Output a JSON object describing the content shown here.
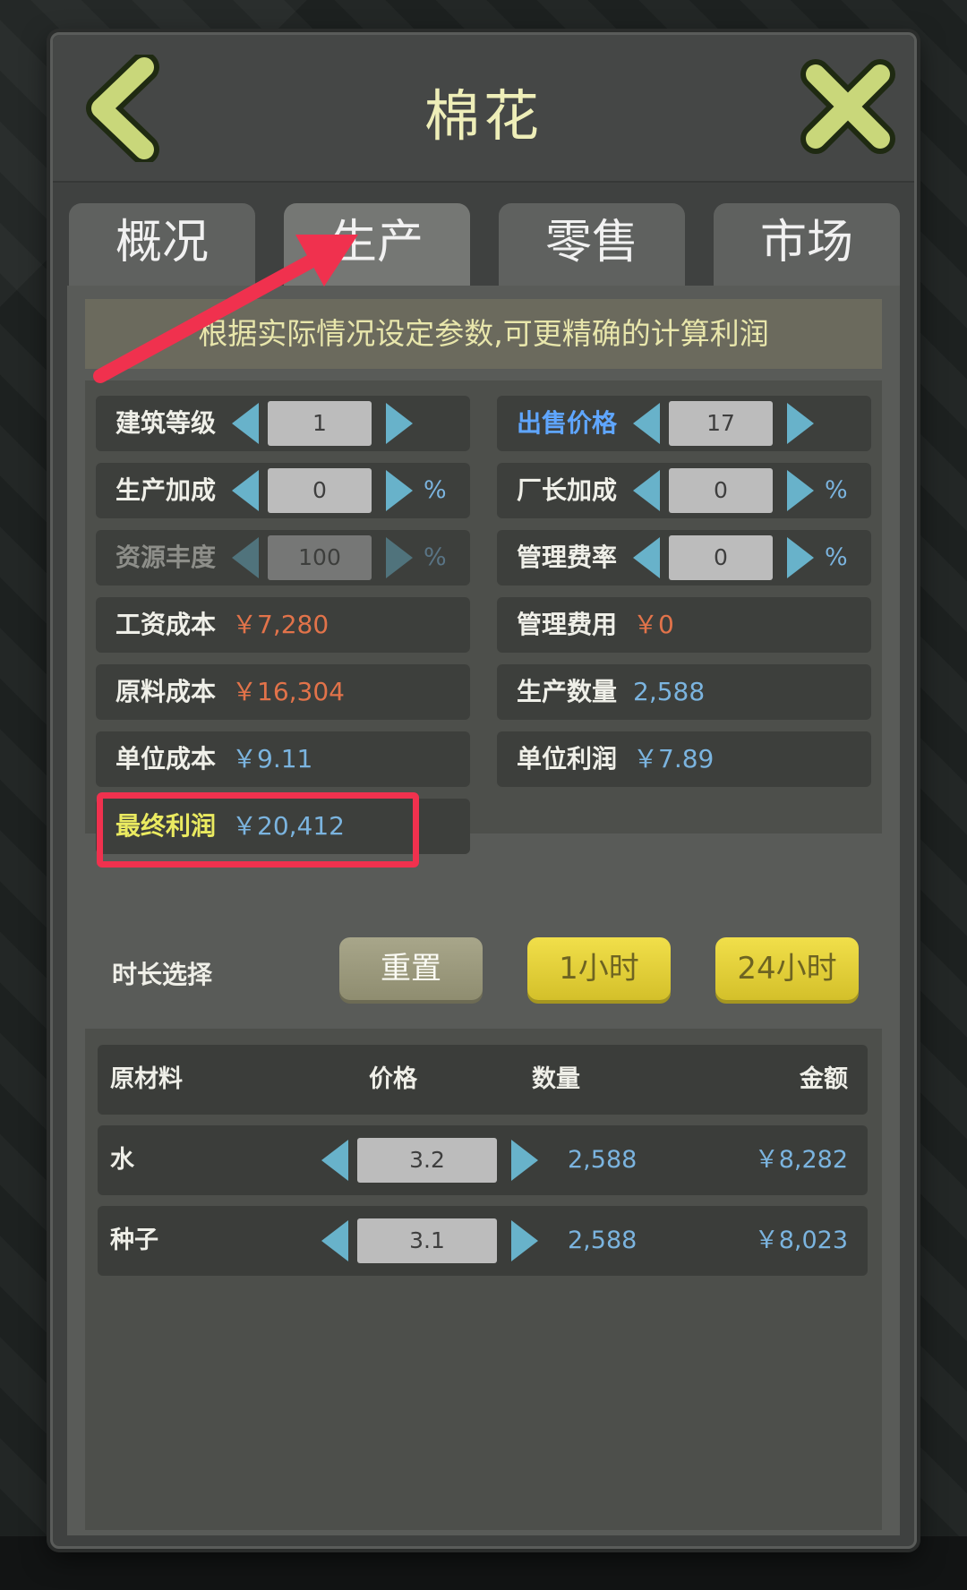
{
  "title": "棉花",
  "header": {
    "back_icon": "chevron-left-icon",
    "close_icon": "close-x-icon"
  },
  "tabs": [
    {
      "label": "概况"
    },
    {
      "label": "生产",
      "active": true
    },
    {
      "label": "零售"
    },
    {
      "label": "市场"
    }
  ],
  "notice": "根据实际情况设定参数,可更精确的计算利润",
  "params": {
    "building_level": {
      "label": "建筑等级",
      "value": "1"
    },
    "sale_price": {
      "label": "出售价格",
      "value": "17"
    },
    "production_bonus": {
      "label": "生产加成",
      "value": "0",
      "unit": "%"
    },
    "manager_bonus": {
      "label": "厂长加成",
      "value": "0",
      "unit": "%"
    },
    "resource_richness": {
      "label": "资源丰度",
      "value": "100",
      "unit": "%"
    },
    "management_rate": {
      "label": "管理费率",
      "value": "0",
      "unit": "%"
    },
    "wage_cost": {
      "label": "工资成本",
      "value": "￥7,280"
    },
    "management_fee": {
      "label": "管理费用",
      "value": "￥0"
    },
    "material_cost": {
      "label": "原料成本",
      "value": "￥16,304"
    },
    "production_qty": {
      "label": "生产数量",
      "value": "2,588"
    },
    "unit_cost": {
      "label": "单位成本",
      "value": "￥9.11"
    },
    "unit_profit": {
      "label": "单位利润",
      "value": "￥7.89"
    },
    "final_profit": {
      "label": "最终利润",
      "value": "￥20,412"
    }
  },
  "duration": {
    "label": "时长选择",
    "reset": "重置",
    "one_hour": "1小时",
    "twentyfour_hours": "24小时"
  },
  "materials": {
    "headers": {
      "name": "原材料",
      "price": "价格",
      "quantity": "数量",
      "amount": "金额"
    },
    "rows": [
      {
        "name": "水",
        "price": "3.2",
        "quantity": "2,588",
        "amount": "￥8,282"
      },
      {
        "name": "种子",
        "price": "3.1",
        "quantity": "2,588",
        "amount": "￥8,023"
      }
    ]
  },
  "colors": {
    "accent_yellow": "#eaea60",
    "money_red": "#e2734a",
    "value_blue": "#7bb4df",
    "stepper_blue": "#68b2ca",
    "annotation_red": "#f0314e"
  }
}
